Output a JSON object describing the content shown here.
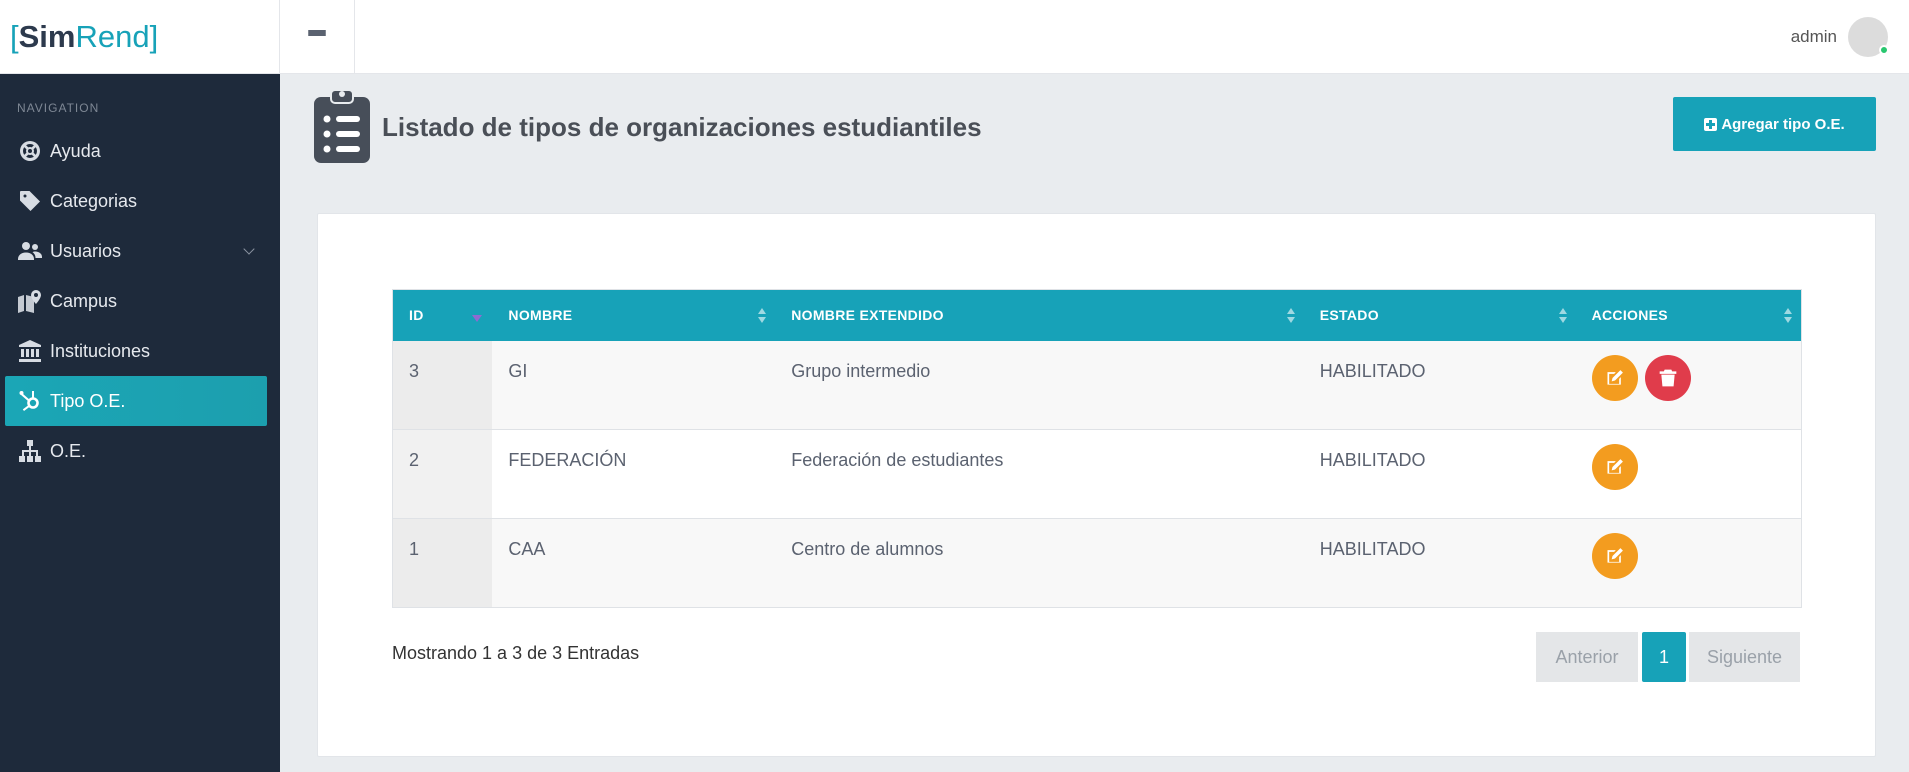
{
  "app": {
    "logo_open": "[",
    "logo_sim": "Sim",
    "logo_rend": "Rend",
    "logo_close": "]"
  },
  "topbar": {
    "menu_icon": "hamburger-icon",
    "user_name": "admin"
  },
  "sidebar": {
    "heading": "NAVIGATION",
    "items": [
      {
        "label": "Ayuda",
        "icon": "lifebuoy-icon"
      },
      {
        "label": "Categorias",
        "icon": "tag-icon"
      },
      {
        "label": "Usuarios",
        "icon": "users-icon",
        "has_submenu": true
      },
      {
        "label": "Campus",
        "icon": "map-marker-icon"
      },
      {
        "label": "Instituciones",
        "icon": "university-icon"
      },
      {
        "label": "Tipo O.E.",
        "icon": "hubspot-icon",
        "active": true
      },
      {
        "label": "O.E.",
        "icon": "sitemap-icon"
      }
    ]
  },
  "page": {
    "title": "Listado de tipos de organizaciones estudiantiles",
    "title_icon": "clipboard-list-icon",
    "add_button": "Agregar tipo O.E."
  },
  "table": {
    "columns": [
      "ID",
      "NOMBRE",
      "NOMBRE EXTENDIDO",
      "ESTADO",
      "ACCIONES"
    ],
    "rows": [
      {
        "id": "3",
        "nombre": "GI",
        "nombre_extendido": "Grupo intermedio",
        "estado": "HABILITADO",
        "actions": [
          "edit",
          "delete"
        ]
      },
      {
        "id": "2",
        "nombre": "FEDERACIÓN",
        "nombre_extendido": "Federación de estudiantes",
        "estado": "HABILITADO",
        "actions": [
          "edit"
        ]
      },
      {
        "id": "1",
        "nombre": "CAA",
        "nombre_extendido": "Centro de alumnos",
        "estado": "HABILITADO",
        "actions": [
          "edit"
        ]
      }
    ],
    "info": "Mostrando 1 a 3 de 3 Entradas"
  },
  "pagination": {
    "prev": "Anterior",
    "current": "1",
    "next": "Siguiente"
  },
  "colors": {
    "accent": "#17a2b8",
    "sidebar_bg": "#1e2a3b",
    "edit": "#f39c1f",
    "delete": "#e03c4b"
  }
}
